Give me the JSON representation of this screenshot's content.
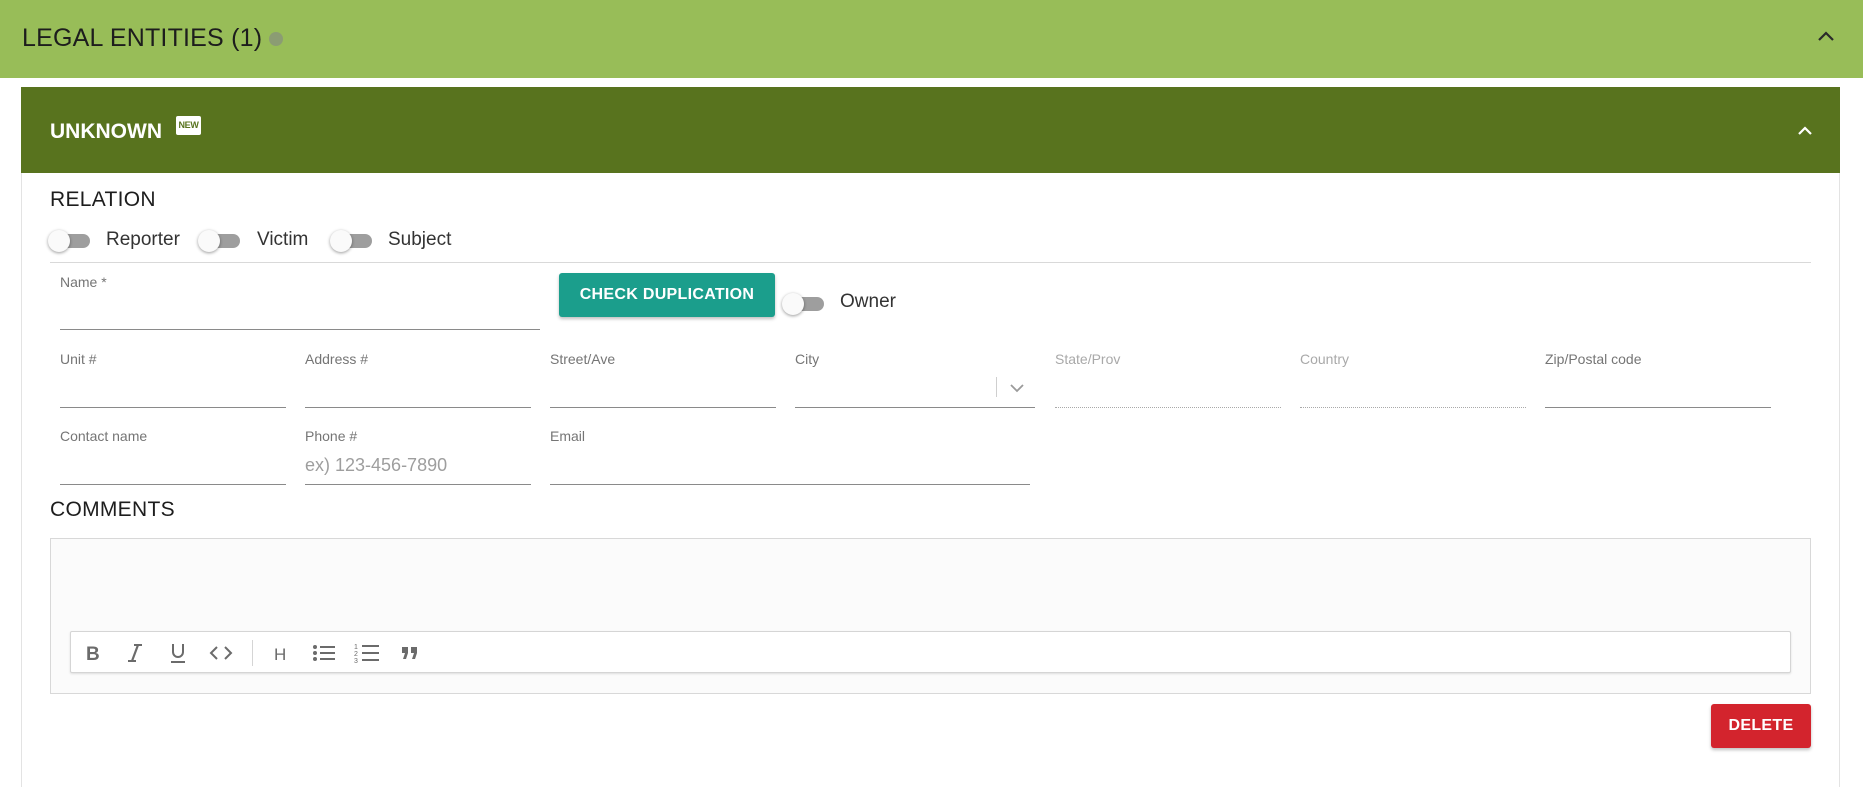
{
  "header": {
    "title": "LEGAL ENTITIES (1)",
    "info_icon": "info-dot-icon",
    "collapse_icon": "chevron-up-icon",
    "color": "#98bd58"
  },
  "entity": {
    "title": "UNKNOWN",
    "badge": "NEW",
    "collapse_icon": "chevron-up-icon",
    "color": "#58731e"
  },
  "relation": {
    "title": "RELATION",
    "toggles": [
      {
        "label": "Reporter",
        "on": false
      },
      {
        "label": "Victim",
        "on": false
      },
      {
        "label": "Subject",
        "on": false
      }
    ]
  },
  "form": {
    "name_label": "Name *",
    "check_button": "CHECK DUPLICATION",
    "check_button_color": "#1b9e8c",
    "owner_label": "Owner",
    "owner_on": false,
    "unit_label": "Unit #",
    "address_label": "Address #",
    "street_label": "Street/Ave",
    "city_label": "City",
    "state_label": "State/Prov",
    "country_label": "Country",
    "zip_label": "Zip/Postal code",
    "contact_label": "Contact name",
    "phone_label": "Phone #",
    "phone_placeholder": "ex) 123-456-7890",
    "email_label": "Email"
  },
  "comments": {
    "title": "COMMENTS",
    "toolbar": [
      "bold-icon",
      "italic-icon",
      "underline-icon",
      "code-icon",
      "heading-icon",
      "bulleted-list-icon",
      "numbered-list-icon",
      "quote-icon"
    ]
  },
  "delete_button": "DELETE",
  "delete_button_color": "#d3242d"
}
